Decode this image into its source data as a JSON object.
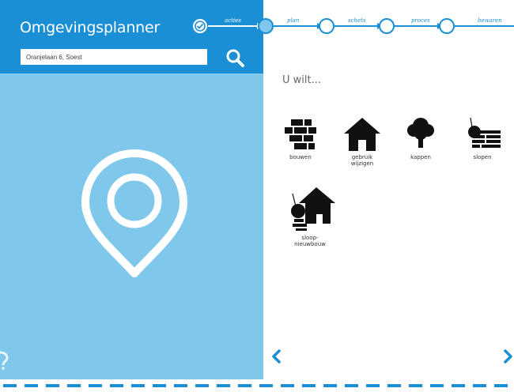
{
  "app": {
    "title": "Omgevingsplanner"
  },
  "search": {
    "value": "Oranjelaan 6, Soest",
    "icon": "search-icon"
  },
  "steps": [
    {
      "label": "acties",
      "state": "done"
    },
    {
      "label": "plan",
      "state": "current"
    },
    {
      "label": "schets",
      "state": "todo"
    },
    {
      "label": "proces",
      "state": "todo"
    },
    {
      "label": "bewaren",
      "state": "todo"
    }
  ],
  "main": {
    "prompt": "U wilt...",
    "options": [
      {
        "label": "bouwen",
        "icon": "bricks-icon"
      },
      {
        "label": "gebruik\nwijzigen",
        "icon": "house-icon"
      },
      {
        "label": "kappen",
        "icon": "tree-icon"
      },
      {
        "label": "slopen",
        "icon": "wrecking-ball-wall-icon"
      },
      {
        "label": "sloop-\nnieuwbouw",
        "icon": "wrecking-ball-house-icon"
      }
    ]
  },
  "nav": {
    "prev_icon": "chevron-left-icon",
    "next_icon": "chevron-right-icon"
  },
  "colors": {
    "header": "#1a8fd6",
    "map": "#7fc8ec",
    "accent": "#1a8fd6"
  }
}
